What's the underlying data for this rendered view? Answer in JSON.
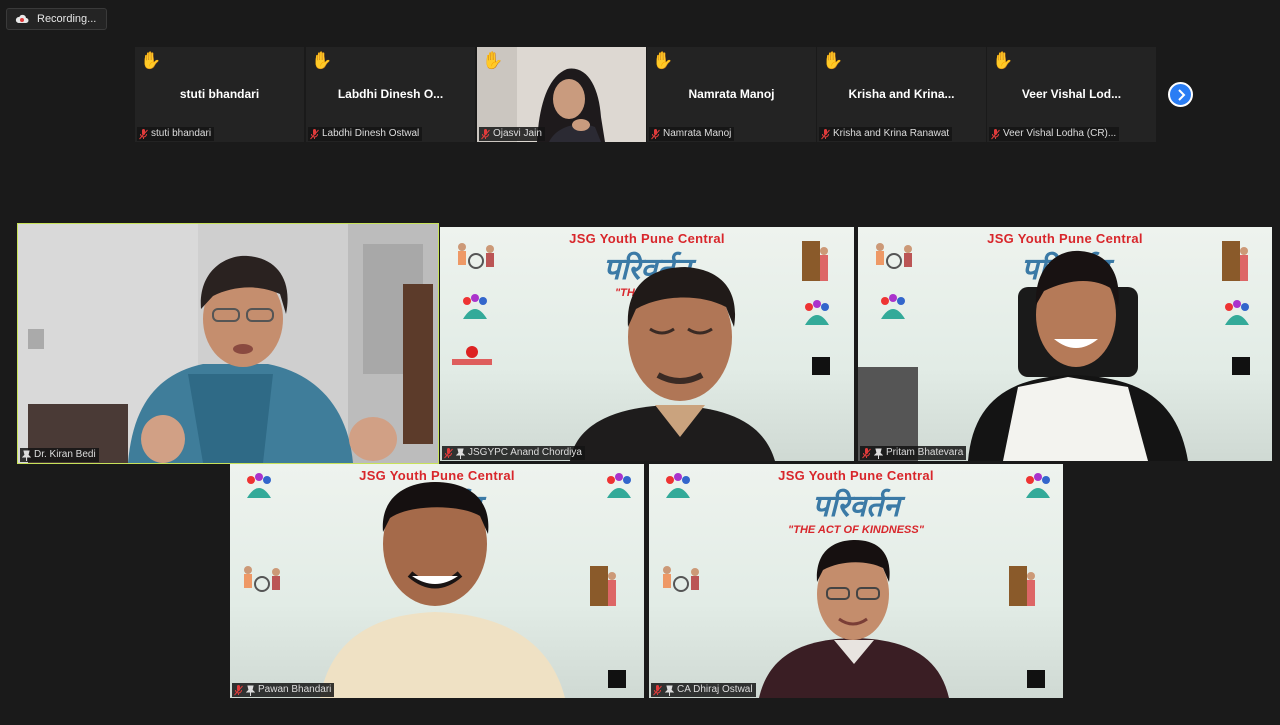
{
  "recording": {
    "label": "Recording..."
  },
  "strip": [
    {
      "center_name": "stuti bhandari",
      "tag": "stuti bhandari",
      "hand": "✋"
    },
    {
      "center_name": "Labdhi  Dinesh  O...",
      "tag": "Labdhi Dinesh Ostwal",
      "hand": "✋"
    },
    {
      "center_name": "",
      "tag": "Ojasvi Jain",
      "hand": "✋"
    },
    {
      "center_name": "Namrata Manoj",
      "tag": "Namrata Manoj",
      "hand": "✋"
    },
    {
      "center_name": "Krisha and Krina...",
      "tag": "Krisha and Krina Ranawat",
      "hand": "✋"
    },
    {
      "center_name": "Veer Vishal Lod...",
      "tag": "Veer Vishal Lodha (CR)...",
      "hand": "✋"
    }
  ],
  "tiles": [
    {
      "tag": "Dr. Kiran Bedi"
    },
    {
      "tag": "JSGYPC Anand Chordiya",
      "title": "JSG  Youth Pune Central",
      "hindi": "परिवर्तन",
      "sub": "\"THE ACT O"
    },
    {
      "tag": "Pritam Bhatevara",
      "title": "JSG  Youth Pune Central",
      "hindi": "परिवर्तन",
      "sub": "\"THE A"
    },
    {
      "tag": "Pawan Bhandari",
      "title": "JSG  Youth Pune Central",
      "hindi": "परिवर्तन",
      "sub": "\"T             NESS\""
    },
    {
      "tag": "CA Dhiraj Ostwal",
      "title": "JSG  Youth Pune Central",
      "hindi": "परिवर्तन",
      "sub": "\"THE ACT OF KINDNESS\""
    }
  ],
  "colors": {
    "active_border": "#c8e25a",
    "accent_blue": "#2a7df4",
    "banner_red": "#d8262b"
  }
}
